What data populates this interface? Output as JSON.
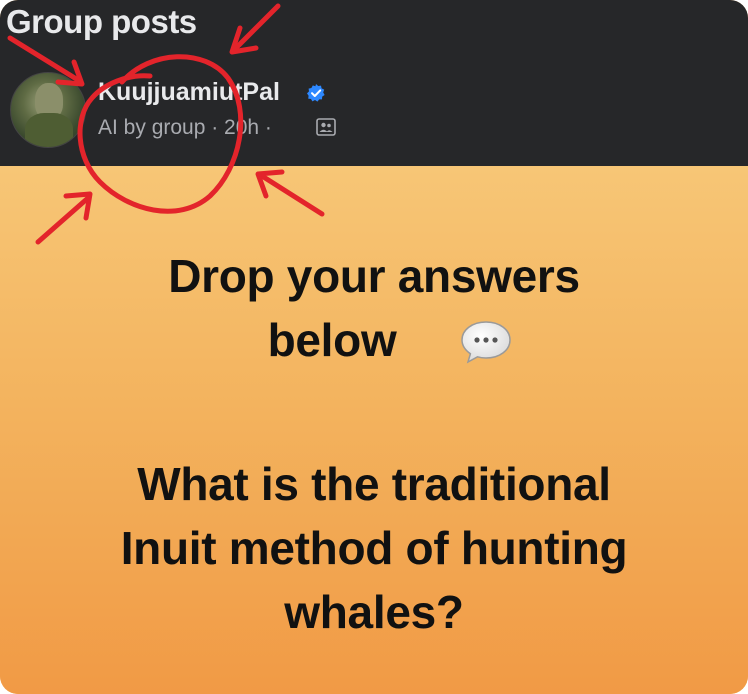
{
  "header": {
    "section_title": "Group posts"
  },
  "post": {
    "author_name": "KuujjuamiutPal",
    "meta_text": "AI by group · 20h ·",
    "verified_badge_icon": "verified-badge-icon",
    "audience_icon": "group-audience-icon",
    "avatar_icon": "avatar"
  },
  "content": {
    "line1": "Drop your answers",
    "line2": "below",
    "emoji_icon": "speech-bubble-icon",
    "question_line1": "What is the traditional",
    "question_line2": "Inuit method of hunting",
    "question_line3": "whales?"
  },
  "annotations": {
    "arrow_color": "#e3242b",
    "circle_color": "#e3242b"
  }
}
